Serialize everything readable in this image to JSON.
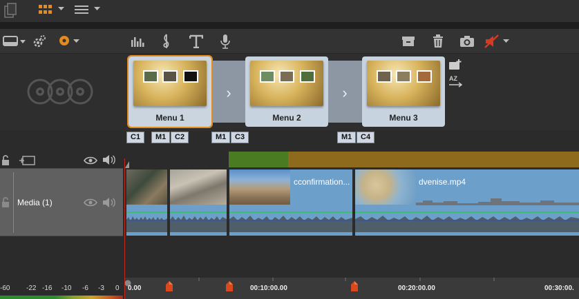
{
  "toolbar_top": {
    "icons": [
      "pages-icon",
      "grid-view-icon",
      "chevron-down-icon",
      "list-view-icon",
      "chevron-down-icon"
    ]
  },
  "toolbar": {
    "left_icons": [
      "monitor-icon",
      "chevron-down-icon",
      "settings-icon",
      "record-icon",
      "chevron-down-icon"
    ],
    "center_icons": [
      "audio-mixer-icon",
      "music-note-icon",
      "title-icon",
      "microphone-icon"
    ],
    "right_icons": [
      "archive-icon",
      "trash-icon",
      "camera-icon",
      "no-audio-icon",
      "chevron-down-icon"
    ]
  },
  "disc_menus": {
    "items": [
      {
        "label": "Menu 1",
        "selected": true
      },
      {
        "label": "Menu 2",
        "selected": false
      },
      {
        "label": "Menu 3",
        "selected": false
      }
    ],
    "side_icons": [
      "add-menu-icon",
      "sort-az-icon"
    ]
  },
  "chapter_markers": [
    {
      "label": "C1"
    },
    {
      "label": "M1"
    },
    {
      "label": "C2"
    },
    {
      "label": "M1"
    },
    {
      "label": "C3"
    },
    {
      "label": "M1"
    },
    {
      "label": "C4"
    }
  ],
  "tracks": {
    "header_track_icons": [
      "lock-icon",
      "track-add-icon",
      "eye-icon",
      "speaker-icon"
    ],
    "media_track": {
      "name": "Media (1)",
      "icons": [
        "lock-icon",
        "eye-icon",
        "speaker-icon"
      ]
    }
  },
  "clips": [
    {
      "name": ""
    },
    {
      "name": ""
    },
    {
      "name": "cconfirmation..."
    },
    {
      "name": "dvenise.mp4"
    }
  ],
  "vu_meter": {
    "labels": [
      "-60",
      "-22",
      "-16",
      "-10",
      "-6",
      "-3",
      "0"
    ]
  },
  "timeline": {
    "timecodes": [
      "0.00",
      "00:10:00.00",
      "00:20:00.00",
      "00:30:00."
    ]
  },
  "colors": {
    "accent": "#e58a1f",
    "clip_blue": "#6c9fca",
    "playhead": "#c2281e",
    "track_green": "#4a7a22",
    "track_gold": "#8e6a1c"
  }
}
